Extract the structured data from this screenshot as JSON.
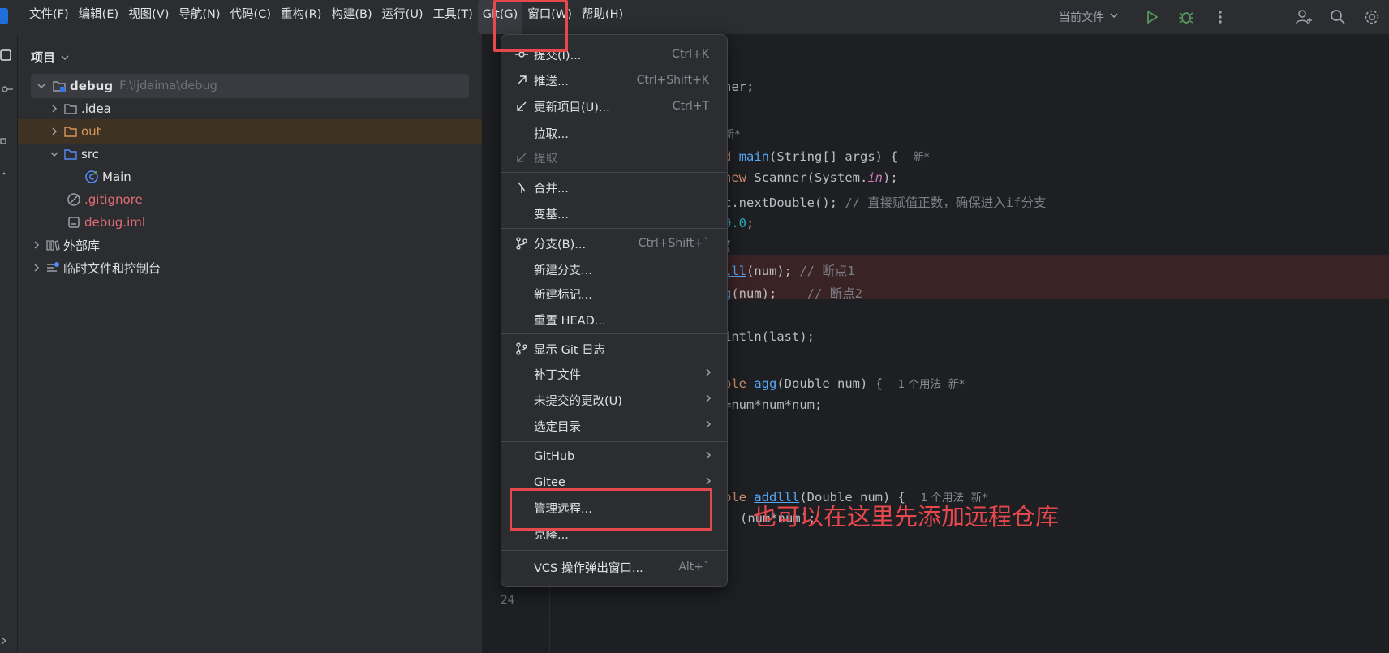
{
  "menubar": {
    "items": [
      "文件(F)",
      "编辑(E)",
      "视图(V)",
      "导航(N)",
      "代码(C)",
      "重构(R)",
      "构建(B)",
      "运行(U)",
      "工具(T)",
      "Git(G)",
      "窗口(W)",
      "帮助(H)"
    ]
  },
  "toolbar": {
    "run_config": "当前文件"
  },
  "project_panel": {
    "title": "项目",
    "tree": [
      {
        "label": "debug",
        "hint": "F:\\ljdaima\\debug"
      },
      {
        "label": ".idea"
      },
      {
        "label": "out"
      },
      {
        "label": "src"
      },
      {
        "label": "Main"
      },
      {
        "label": ".gitignore"
      },
      {
        "label": "debug.iml"
      },
      {
        "label": "外部库"
      },
      {
        "label": "临时文件和控制台"
      }
    ]
  },
  "editor": {
    "line_number": "24",
    "lines": {
      "l1": "ner;",
      "l2_a": "新*",
      "l3_a": "d ",
      "l3_b": "main",
      "l3_c": "(String[] args) {",
      "l3_hint": "新*",
      "l4_a": "new",
      "l4_b": " Scanner(System.",
      "l4_c": "in",
      "l4_d": ");",
      "l5_a": "c.nextDouble();",
      "l5_cmt": " // 直接赋值正数，确保进入if分支",
      "l6_a": "0.0",
      "l6_b": ";",
      "l7": "{",
      "l8_a": "lll",
      "l8_b": "(num);",
      "l8_cmt": " // 断点1",
      "l9_a": "g",
      "l9_b": "(num);    ",
      "l9_cmt": "// 断点2",
      "l10_a": "intln(",
      "l10_b": "last",
      "l10_c": ");",
      "l11_a": "ble ",
      "l11_b": "agg",
      "l11_c": "(Double num) {",
      "l11_hint": "1 个用法  新*",
      "l12": "=num*num*num;",
      "l13_a": "ble ",
      "l13_b": "addlll",
      "l13_c": "(Double num) {",
      "l13_hint": "1 个用法  新*",
      "l14": "(num*num);"
    }
  },
  "git_menu": {
    "items": [
      {
        "label": "提交(I)...",
        "shortcut": "Ctrl+K"
      },
      {
        "label": "推送...",
        "shortcut": "Ctrl+Shift+K"
      },
      {
        "label": "更新项目(U)...",
        "shortcut": "Ctrl+T"
      },
      {
        "label": "拉取..."
      },
      {
        "label": "提取"
      },
      {
        "label": "合并..."
      },
      {
        "label": "变基..."
      },
      {
        "label": "分支(B)...",
        "shortcut": "Ctrl+Shift+`"
      },
      {
        "label": "新建分支..."
      },
      {
        "label": "新建标记..."
      },
      {
        "label": "重置 HEAD..."
      },
      {
        "label": "显示 Git 日志"
      },
      {
        "label": "补丁文件"
      },
      {
        "label": "未提交的更改(U)"
      },
      {
        "label": "选定目录"
      },
      {
        "label": "GitHub"
      },
      {
        "label": "Gitee"
      },
      {
        "label": "管理远程..."
      },
      {
        "label": "克隆..."
      },
      {
        "label": "VCS 操作弹出窗口...",
        "shortcut": "Alt+`"
      }
    ]
  },
  "annotation": {
    "text": "也可以在这里先添加远程仓库"
  },
  "colors": {
    "accent_red": "#e5484d",
    "menu_bg": "#2b2d30",
    "editor_bg": "#1e1f22"
  }
}
